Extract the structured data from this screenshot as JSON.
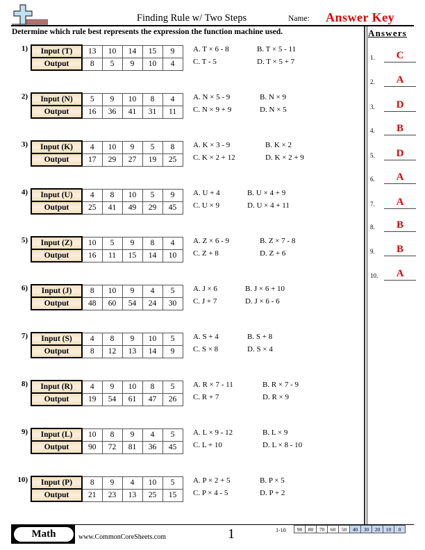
{
  "header": {
    "title": "Finding Rule w/ Two Steps",
    "name_label": "Name:",
    "name_value": "Answer Key",
    "logo_icon": "plus-minus-logo-icon"
  },
  "instructions": "Determine which rule best represents the expression the function machine used.",
  "answers": {
    "title": "Answers",
    "items": [
      {
        "num": "1.",
        "value": "C"
      },
      {
        "num": "2.",
        "value": "A"
      },
      {
        "num": "3.",
        "value": "D"
      },
      {
        "num": "4.",
        "value": "B"
      },
      {
        "num": "5.",
        "value": "D"
      },
      {
        "num": "6.",
        "value": "A"
      },
      {
        "num": "7.",
        "value": "A"
      },
      {
        "num": "8.",
        "value": "B"
      },
      {
        "num": "9.",
        "value": "B"
      },
      {
        "num": "10.",
        "value": "A"
      }
    ]
  },
  "problems": [
    {
      "num": "1)",
      "input_label": "Input (T)",
      "output_label": "Output",
      "inputs": [
        "13",
        "10",
        "14",
        "15",
        "9"
      ],
      "outputs": [
        "8",
        "5",
        "9",
        "10",
        "4"
      ],
      "choices": {
        "A": "A. T × 6 - 8",
        "B": "B. T × 5 - 11",
        "C": "C. T - 5",
        "D": "D. T × 5 + 7"
      }
    },
    {
      "num": "2)",
      "input_label": "Input (N)",
      "output_label": "Output",
      "inputs": [
        "5",
        "9",
        "10",
        "8",
        "4"
      ],
      "outputs": [
        "16",
        "36",
        "41",
        "31",
        "11"
      ],
      "choices": {
        "A": "A. N × 5 - 9",
        "B": "B. N × 9",
        "C": "C. N × 9 + 9",
        "D": "D. N × 5"
      }
    },
    {
      "num": "3)",
      "input_label": "Input (K)",
      "output_label": "Output",
      "inputs": [
        "4",
        "10",
        "9",
        "5",
        "8"
      ],
      "outputs": [
        "17",
        "29",
        "27",
        "19",
        "25"
      ],
      "choices": {
        "A": "A. K × 3 - 9",
        "B": "B. K × 2",
        "C": "C. K × 2 + 12",
        "D": "D. K × 2 + 9"
      }
    },
    {
      "num": "4)",
      "input_label": "Input (U)",
      "output_label": "Output",
      "inputs": [
        "4",
        "8",
        "10",
        "5",
        "9"
      ],
      "outputs": [
        "25",
        "41",
        "49",
        "29",
        "45"
      ],
      "choices": {
        "A": "A. U + 4",
        "B": "B. U × 4 + 9",
        "C": "C. U × 9",
        "D": "D. U × 4 + 11"
      }
    },
    {
      "num": "5)",
      "input_label": "Input (Z)",
      "output_label": "Output",
      "inputs": [
        "10",
        "5",
        "9",
        "8",
        "4"
      ],
      "outputs": [
        "16",
        "11",
        "15",
        "14",
        "10"
      ],
      "choices": {
        "A": "A. Z × 6 - 9",
        "B": "B. Z × 7 - 8",
        "C": "C. Z + 8",
        "D": "D. Z + 6"
      }
    },
    {
      "num": "6)",
      "input_label": "Input (J)",
      "output_label": "Output",
      "inputs": [
        "8",
        "10",
        "9",
        "4",
        "5"
      ],
      "outputs": [
        "48",
        "60",
        "54",
        "24",
        "30"
      ],
      "choices": {
        "A": "A. J × 6",
        "B": "B. J × 6 + 10",
        "C": "C. J + 7",
        "D": "D. J × 6 - 6"
      }
    },
    {
      "num": "7)",
      "input_label": "Input (S)",
      "output_label": "Output",
      "inputs": [
        "4",
        "8",
        "9",
        "10",
        "5"
      ],
      "outputs": [
        "8",
        "12",
        "13",
        "14",
        "9"
      ],
      "choices": {
        "A": "A. S + 4",
        "B": "B. S + 8",
        "C": "C. S × 8",
        "D": "D. S × 4"
      }
    },
    {
      "num": "8)",
      "input_label": "Input (R)",
      "output_label": "Output",
      "inputs": [
        "4",
        "9",
        "10",
        "8",
        "5"
      ],
      "outputs": [
        "19",
        "54",
        "61",
        "47",
        "26"
      ],
      "choices": {
        "A": "A. R × 7 - 11",
        "B": "B. R × 7 - 9",
        "C": "C. R + 7",
        "D": "D. R × 9"
      }
    },
    {
      "num": "9)",
      "input_label": "Input (L)",
      "output_label": "Output",
      "inputs": [
        "10",
        "8",
        "9",
        "4",
        "5"
      ],
      "outputs": [
        "90",
        "72",
        "81",
        "36",
        "45"
      ],
      "choices": {
        "A": "A. L × 9 - 12",
        "B": "B. L × 9",
        "C": "C. L + 10",
        "D": "D. L × 8 - 10"
      }
    },
    {
      "num": "10)",
      "input_label": "Input (P)",
      "output_label": "Output",
      "inputs": [
        "8",
        "9",
        "4",
        "10",
        "5"
      ],
      "outputs": [
        "21",
        "23",
        "13",
        "25",
        "15"
      ],
      "choices": {
        "A": "A. P × 2 + 5",
        "B": "B. P × 5",
        "C": "C. P × 4 - 5",
        "D": "D. P + 2"
      }
    }
  ],
  "footer": {
    "subject": "Math",
    "website": "www.CommonCoreSheets.com",
    "page": "1",
    "score_label": "1-10",
    "scores": [
      "90",
      "80",
      "70",
      "60",
      "50",
      "40",
      "30",
      "20",
      "10",
      "0"
    ],
    "highlighted_from": "40"
  }
}
